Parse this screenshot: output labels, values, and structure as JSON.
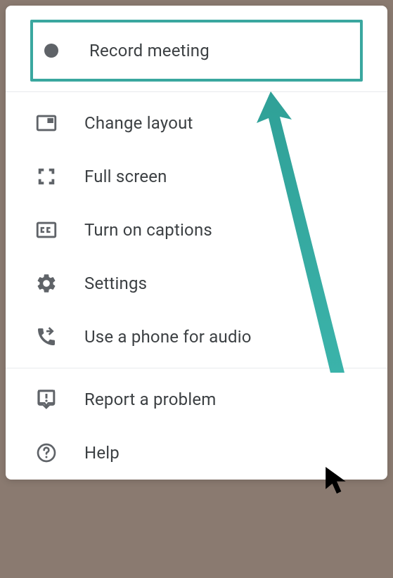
{
  "menu": {
    "record_label": "Record meeting",
    "change_layout_label": "Change layout",
    "full_screen_label": "Full screen",
    "captions_label": "Turn on captions",
    "settings_label": "Settings",
    "phone_audio_label": "Use a phone for audio",
    "report_problem_label": "Report a problem",
    "help_label": "Help"
  },
  "colors": {
    "highlight": "#3aa79f",
    "icon": "#5f6368",
    "text": "#3c4043"
  },
  "annotations": {
    "arrow_target": "record-meeting-item",
    "cursor_present": true
  }
}
